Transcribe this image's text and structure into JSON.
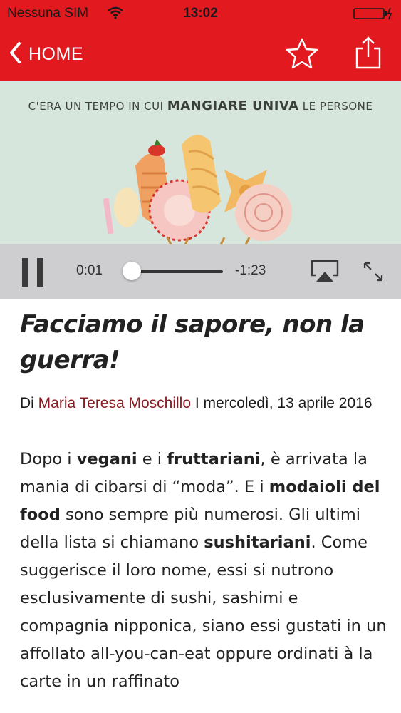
{
  "status_bar": {
    "carrier": "Nessuna SIM",
    "time": "13:02"
  },
  "nav": {
    "back_label": "HOME"
  },
  "video": {
    "caption_pre": "C'ERA UN TEMPO IN CUI ",
    "caption_bold": "MANGIARE UNIVA",
    "caption_post": " LE PERSONE",
    "elapsed": "0:01",
    "remaining": "-1:23",
    "progress": 0.01
  },
  "article": {
    "title": "Facciamo il sapore, non la guerra!",
    "byline_prefix": "Di ",
    "author": "Maria Teresa Moschillo",
    "byline_separator": " I ",
    "date": "mercoledì, 13 aprile 2016",
    "body": {
      "p1": "Dopo i ",
      "b1": "vegani",
      "p2": " e i ",
      "b2": "fruttariani",
      "p3": ", è arrivata la mania di cibarsi di “moda”. E i ",
      "b3": "modaioli del food",
      "p4": " sono sempre più numerosi. Gli ultimi della lista si chiamano ",
      "b4": "sushitariani",
      "p5": ". Come suggerisce il loro nome, essi si nutrono esclusivamente di sushi, sashimi e compagnia nipponica, siano essi gustati in un affollato all-you-can-eat oppure ordinati à la carte in un raffinato"
    }
  },
  "colors": {
    "brand_red": "#e21a1f",
    "author_link": "#8c1a22",
    "video_bg": "#d7e6dd"
  }
}
